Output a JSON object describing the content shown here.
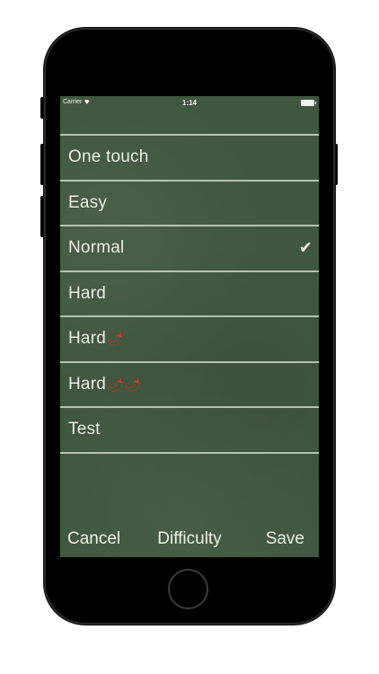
{
  "status_bar": {
    "carrier": "Carrier",
    "time": "1:14"
  },
  "difficulty_options": [
    {
      "label": "One touch",
      "peppers": "",
      "selected": false
    },
    {
      "label": "Easy",
      "peppers": "",
      "selected": false
    },
    {
      "label": "Normal",
      "peppers": "",
      "selected": true
    },
    {
      "label": "Hard",
      "peppers": "",
      "selected": false
    },
    {
      "label": "Hard",
      "peppers": "🌶",
      "selected": false
    },
    {
      "label": "Hard",
      "peppers": "🌶🌶",
      "selected": false
    },
    {
      "label": "Test",
      "peppers": "",
      "selected": false
    }
  ],
  "check_mark": "✔",
  "toolbar": {
    "cancel_label": "Cancel",
    "title": "Difficulty",
    "save_label": "Save"
  },
  "colors": {
    "felt_green": "#40573f",
    "divider": "#c9d6c4",
    "text": "#eef0e6"
  }
}
